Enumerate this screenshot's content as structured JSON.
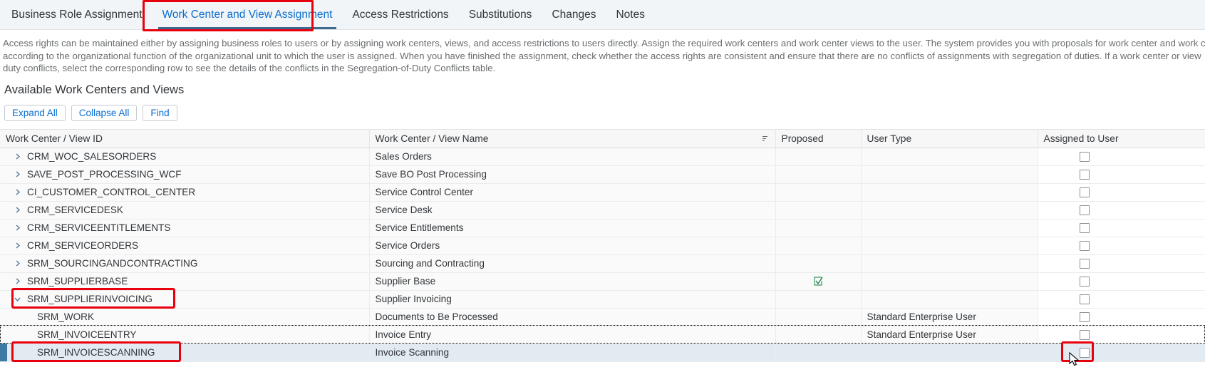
{
  "tabs": [
    {
      "label": "Business Role Assignment",
      "selected": false
    },
    {
      "label": "Work Center and View Assignment",
      "selected": true
    },
    {
      "label": "Access Restrictions",
      "selected": false
    },
    {
      "label": "Substitutions",
      "selected": false
    },
    {
      "label": "Changes",
      "selected": false
    },
    {
      "label": "Notes",
      "selected": false
    }
  ],
  "description": {
    "line1": "Access rights can be maintained either by assigning business roles to users or by assigning work centers, views, and access restrictions to users directly. Assign the required work centers and work center views to the user. The system provides you with proposals for work center and work c",
    "line2": "according to the organizational function of the organizational unit to which the user is assigned. When you have finished the assignment, check whether the access rights are consistent and ensure that there are no conflicts of assignments with segregation of duties. If a work center or view",
    "line3": "duty conflicts, select the corresponding row to see the details of the conflicts in the Segregation-of-Duty Conflicts table."
  },
  "section": {
    "title": "Available Work Centers and Views"
  },
  "toolbar": {
    "expand_all": "Expand All",
    "collapse_all": "Collapse All",
    "find": "Find"
  },
  "table": {
    "headers": {
      "id": "Work Center / View ID",
      "name": "Work Center / View Name",
      "proposed": "Proposed",
      "user_type": "User Type",
      "assigned": "Assigned to User"
    },
    "rows": [
      {
        "id": "CRM_WOC_SALESORDERS",
        "name": "Sales Orders",
        "proposed": "",
        "user_type": "",
        "child": false,
        "expanded": false,
        "checked": false,
        "selected": false
      },
      {
        "id": "SAVE_POST_PROCESSING_WCF",
        "name": "Save BO Post Processing",
        "proposed": "",
        "user_type": "",
        "child": false,
        "expanded": false,
        "checked": false,
        "selected": false
      },
      {
        "id": "CI_CUSTOMER_CONTROL_CENTER",
        "name": "Service Control Center",
        "proposed": "",
        "user_type": "",
        "child": false,
        "expanded": false,
        "checked": false,
        "selected": false
      },
      {
        "id": "CRM_SERVICEDESK",
        "name": "Service Desk",
        "proposed": "",
        "user_type": "",
        "child": false,
        "expanded": false,
        "checked": false,
        "selected": false
      },
      {
        "id": "CRM_SERVICEENTITLEMENTS",
        "name": "Service Entitlements",
        "proposed": "",
        "user_type": "",
        "child": false,
        "expanded": false,
        "checked": false,
        "selected": false
      },
      {
        "id": "CRM_SERVICEORDERS",
        "name": "Service Orders",
        "proposed": "",
        "user_type": "",
        "child": false,
        "expanded": false,
        "checked": false,
        "selected": false
      },
      {
        "id": "SRM_SOURCINGANDCONTRACTING",
        "name": "Sourcing and Contracting",
        "proposed": "",
        "user_type": "",
        "child": false,
        "expanded": false,
        "checked": false,
        "selected": false
      },
      {
        "id": "SRM_SUPPLIERBASE",
        "name": "Supplier Base",
        "proposed": "check",
        "user_type": "",
        "child": false,
        "expanded": false,
        "checked": false,
        "selected": false
      },
      {
        "id": "SRM_SUPPLIERINVOICING",
        "name": "Supplier Invoicing",
        "proposed": "",
        "user_type": "",
        "child": false,
        "expanded": true,
        "checked": false,
        "selected": false
      },
      {
        "id": "SRM_WORK",
        "name": "Documents to Be Processed",
        "proposed": "",
        "user_type": "Standard Enterprise User",
        "child": true,
        "expanded": false,
        "checked": false,
        "selected": false
      },
      {
        "id": "SRM_INVOICEENTRY",
        "name": "Invoice Entry",
        "proposed": "",
        "user_type": "Standard Enterprise User",
        "child": true,
        "expanded": false,
        "checked": false,
        "selected": false
      },
      {
        "id": "SRM_INVOICESCANNING",
        "name": "Invoice Scanning",
        "proposed": "",
        "user_type": "",
        "child": true,
        "expanded": false,
        "checked": false,
        "selected": true
      }
    ]
  },
  "annotations": {
    "tab_highlight_color": "#e8000d",
    "row_highlight_color": "#e8000d",
    "selection_bar_color": "#3f7aa6"
  }
}
